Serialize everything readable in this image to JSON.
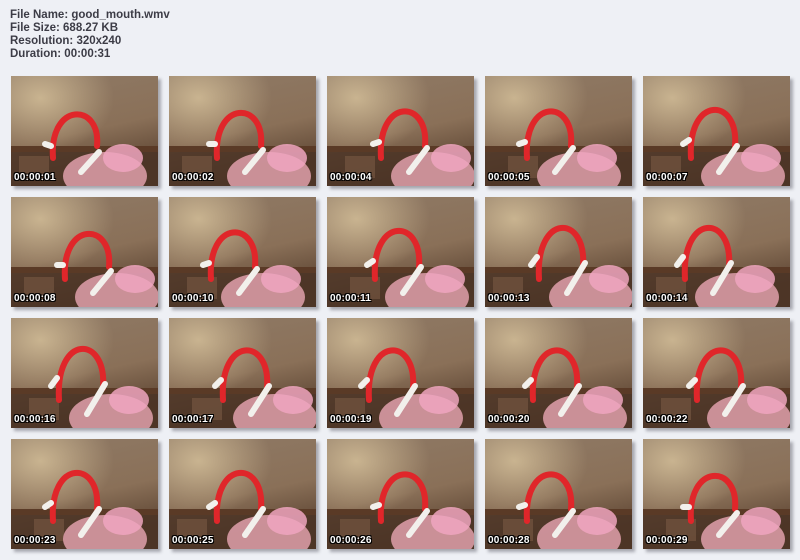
{
  "file_info": {
    "name_line": "File Name: good_mouth.wmv",
    "size_line": "File Size: 688.27 KB",
    "resolution_line": "Resolution: 320x240",
    "duration_line": "Duration: 00:00:31"
  },
  "thumbnails": [
    {
      "timestamp": "00:00:01",
      "hand_level": 0.55
    },
    {
      "timestamp": "00:00:02",
      "hand_level": 0.5
    },
    {
      "timestamp": "00:00:04",
      "hand_level": 0.45
    },
    {
      "timestamp": "00:00:05",
      "hand_level": 0.45
    },
    {
      "timestamp": "00:00:07",
      "hand_level": 0.4
    },
    {
      "timestamp": "00:00:08",
      "hand_level": 0.5
    },
    {
      "timestamp": "00:00:10",
      "hand_level": 0.45
    },
    {
      "timestamp": "00:00:11",
      "hand_level": 0.4
    },
    {
      "timestamp": "00:00:13",
      "hand_level": 0.3
    },
    {
      "timestamp": "00:00:14",
      "hand_level": 0.3
    },
    {
      "timestamp": "00:00:16",
      "hand_level": 0.3
    },
    {
      "timestamp": "00:00:17",
      "hand_level": 0.35
    },
    {
      "timestamp": "00:00:19",
      "hand_level": 0.35
    },
    {
      "timestamp": "00:00:20",
      "hand_level": 0.35
    },
    {
      "timestamp": "00:00:22",
      "hand_level": 0.35
    },
    {
      "timestamp": "00:00:23",
      "hand_level": 0.4
    },
    {
      "timestamp": "00:00:25",
      "hand_level": 0.4
    },
    {
      "timestamp": "00:00:26",
      "hand_level": 0.45
    },
    {
      "timestamp": "00:00:28",
      "hand_level": 0.45
    },
    {
      "timestamp": "00:00:29",
      "hand_level": 0.5
    }
  ],
  "colors": {
    "background": "#eef0f5",
    "header_text": "#3c3c46",
    "balloon": "#e0262a",
    "wall": "#8a7058",
    "shelf": "#5a3a26",
    "glove": "#f2f0ec",
    "hair": "#f0a6c0",
    "timestamp_text": "#ffffff"
  }
}
